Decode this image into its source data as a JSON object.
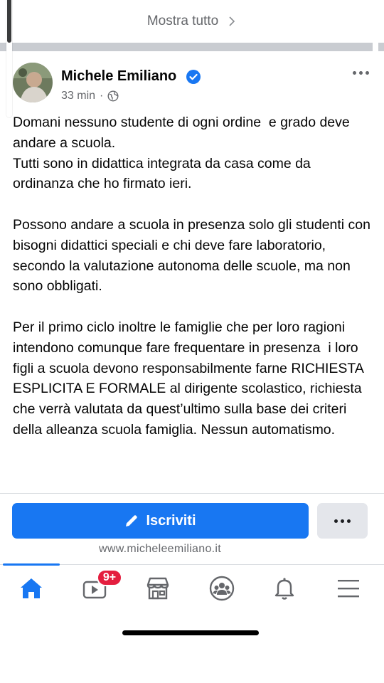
{
  "show_all": {
    "label": "Mostra tutto"
  },
  "post": {
    "author": "Michele Emiliano",
    "time": "33 min",
    "meta_separator": "·",
    "body": "Domani nessuno studente di ogni ordine  e grado deve andare a scuola.\nTutti sono in didattica integrata da casa come da ordinanza che ho firmato ieri.\n\nPossono andare a scuola in presenza solo gli studenti con bisogni didattici speciali e chi deve fare laboratorio, secondo la valutazione autonoma delle scuole, ma non sono obbligati.\n\nPer il primo ciclo inoltre le famiglie che per loro ragioni intendono comunque fare frequentare in presenza  i loro figli a scuola devono responsabilmente farne RICHIESTA ESPLICITA E FORMALE al dirigente scolastico, richiesta   che verrà valutata da quest’ultimo sulla base dei criteri della alleanza scuola famiglia. Nessun automatismo."
  },
  "cta": {
    "label": "Iscriviti",
    "link": "www.micheleemiliano.it"
  },
  "tabbar": {
    "video_badge": "9+",
    "tabs": [
      "home-icon",
      "video-icon",
      "marketplace-icon",
      "groups-icon",
      "notifications-icon",
      "menu-icon"
    ]
  },
  "colors": {
    "accent": "#1877f2",
    "badge": "#e41e3f",
    "text_secondary": "#65676b"
  }
}
